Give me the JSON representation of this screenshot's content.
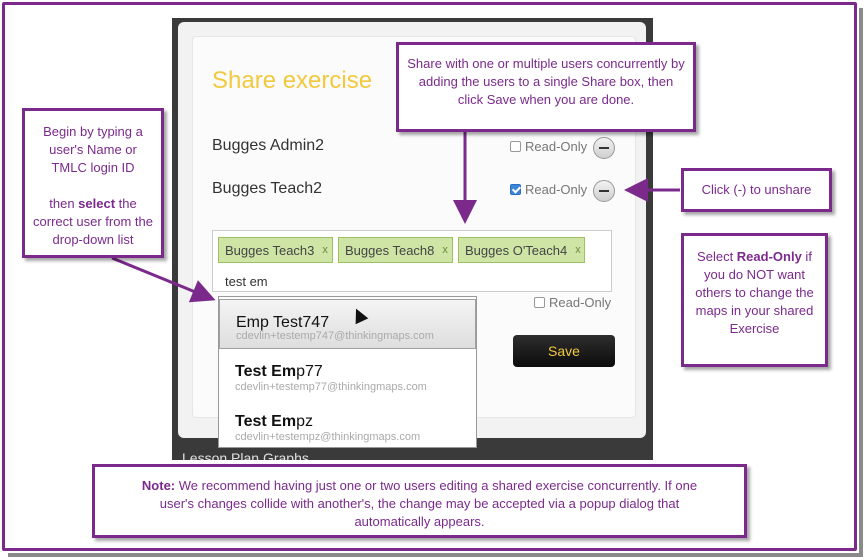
{
  "modal": {
    "title": "Share exercise",
    "users": [
      {
        "name": "Bugges Admin2",
        "read_only_label": "Read-Only",
        "read_only": false
      },
      {
        "name": "Bugges Teach2",
        "read_only_label": "Read-Only",
        "read_only": true
      }
    ],
    "share_tags": [
      {
        "label": "Bugges Teach3",
        "remove": "x"
      },
      {
        "label": "Bugges Teach8",
        "remove": "x"
      },
      {
        "label": "Bugges O'Teach4",
        "remove": "x"
      }
    ],
    "typed_value": "test em",
    "new_read_only_label": "Read-Only",
    "save_label": "Save"
  },
  "dropdown": {
    "items": [
      {
        "name": "Emp Test747",
        "match": "",
        "rest": "",
        "email": "cdevlin+testemp747@thinkingmaps.com"
      },
      {
        "name": "",
        "match": "Test Em",
        "rest": "p77",
        "email": "cdevlin+testemp77@thinkingmaps.com"
      },
      {
        "name": "",
        "match": "Test Em",
        "rest": "pz",
        "email": "cdevlin+testempz@thinkingmaps.com"
      }
    ]
  },
  "backdrop": {
    "partial_text": "Lesson Plan    Graphs"
  },
  "callouts": {
    "top": "Share with one or multiple users concurrently by adding the users to a single Share box, then click Save when you are done.",
    "left_a": "Begin by typing a user's Name or TMLC login ID",
    "left_b_pre": "then ",
    "left_b_bold": "select",
    "left_b_post": " the correct user from the drop-down list",
    "unshare": "Click (-) to unshare",
    "readonly_pre": "Select ",
    "readonly_bold": "Read-Only",
    "readonly_post": " if you do NOT want others to change the maps in your shared Exercise",
    "note_bold": "Note:",
    "note_text": " We recommend having just one or two users editing a shared exercise concurrently.  If one user's changes collide with another's, the change may be accepted via a popup dialog that automatically appears."
  },
  "colors": {
    "accent": "#7b2a8c",
    "title": "#f2c93c",
    "tag_bg": "#cfe5a6",
    "checkbox": "#3b86d9"
  }
}
